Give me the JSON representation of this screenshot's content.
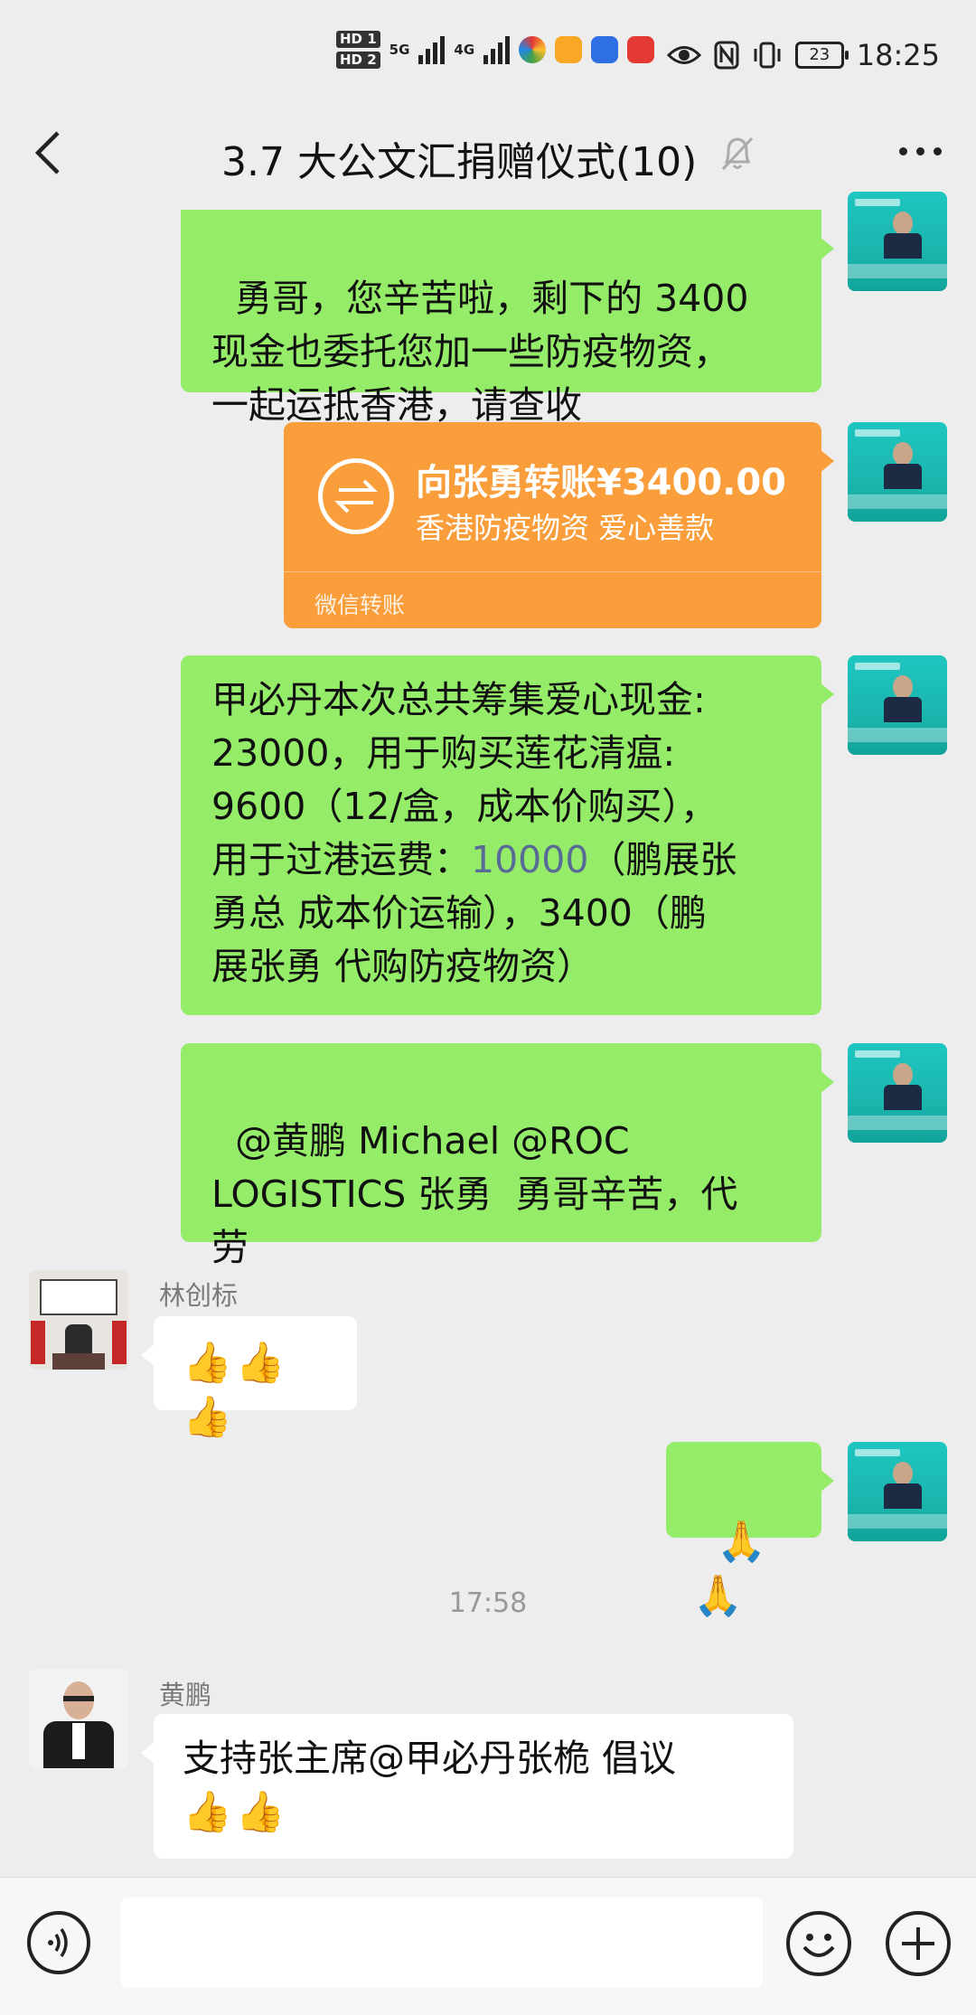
{
  "status_bar": {
    "hd1": "HD 1",
    "hd2": "HD 2",
    "net1": "5G",
    "net2": "4G",
    "battery": "23",
    "time": "18:25"
  },
  "title_bar": {
    "title": "3.7 大公文汇捐赠仪式(10)",
    "muted_icon": "bell-off-icon",
    "more_icon": "more-dots-icon"
  },
  "messages": {
    "m1": "勇哥，您辛苦啦，剩下的 3400\n现金也委托您加一些防疫物资，\n一起运抵香港，请查收",
    "transfer": {
      "amount": "向张勇转账¥3400.00",
      "note": "香港防疫物资 爱心善款",
      "footer": "微信转账"
    },
    "m3_pre": "甲必丹本次总共筹集爱心现金:\n23000，用于购买莲花清瘟:\n9600（12/盒，成本价购买），\n用于过港运费：",
    "m3_link": "10000",
    "m3_post": "（鹏展张\n勇总 成本价运输），3400（鹏\n展张勇 代购防疫物资）",
    "m4": "@黄鹏 Michael @ROC\nLOGISTICS 张勇  勇哥辛苦，代\n劳",
    "m5_sender": "林创标",
    "m5_text": "👍👍👍",
    "m6_text": "🙏🙏",
    "timestamp": "17:58",
    "m7_sender": "黄鹏",
    "m7_line1": "支持张主席@甲必丹张桅  倡议",
    "m7_line2": "👍👍"
  },
  "colors": {
    "bubble_green": "#95ec69",
    "transfer_orange": "#fa9d3b",
    "background": "#ededed",
    "link_blue": "#576b95"
  }
}
